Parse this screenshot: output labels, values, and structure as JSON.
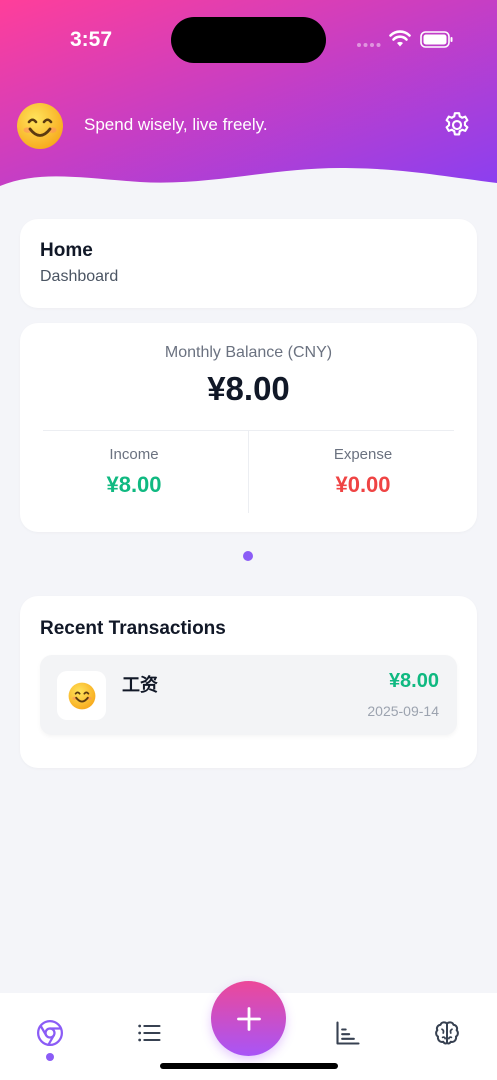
{
  "status_bar": {
    "time": "3:57"
  },
  "header": {
    "avatar_icon": "smiling-face-emoji",
    "avatar_glyph": "😊",
    "tagline": "Spend wisely, live freely.",
    "settings_icon": "gear-icon",
    "gradient": {
      "start": "#ff3e9a",
      "end": "#8b3ff0"
    }
  },
  "page_card": {
    "title": "Home",
    "subtitle": "Dashboard"
  },
  "balance": {
    "label": "Monthly Balance (CNY)",
    "value": "¥8.00",
    "income_label": "Income",
    "income_value": "¥8.00",
    "expense_label": "Expense",
    "expense_value": "¥0.00",
    "income_color": "#10b981",
    "expense_color": "#ef4444"
  },
  "pager": {
    "pages": 1,
    "active": 1
  },
  "transactions": {
    "title": "Recent Transactions",
    "items": [
      {
        "icon": "smiling-face-emoji",
        "glyph": "😊",
        "name": "工资",
        "amount": "¥8.00",
        "date": "2025-09-14"
      }
    ]
  },
  "bottom_nav": {
    "items": [
      {
        "id": "home",
        "icon": "chrome-like-circle-icon",
        "active": true
      },
      {
        "id": "list",
        "icon": "list-icon",
        "active": false
      },
      {
        "id": "add",
        "icon": "plus-icon",
        "active": false
      },
      {
        "id": "stats",
        "icon": "bar-chart-icon",
        "active": false
      },
      {
        "id": "ai",
        "icon": "brain-icon",
        "active": false
      }
    ],
    "accent": "#8b5cf6"
  }
}
